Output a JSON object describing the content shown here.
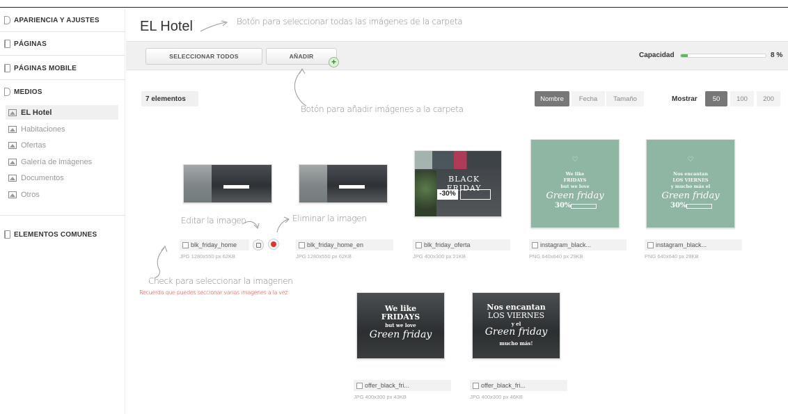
{
  "sidebar": {
    "sections": [
      {
        "label": "APARIENCIA Y AJUSTES"
      },
      {
        "label": "PÁGINAS"
      },
      {
        "label": "PÁGINAS MOBILE"
      },
      {
        "label": "MEDIOS"
      },
      {
        "label": "ELEMENTOS COMUNES"
      }
    ],
    "media_items": [
      {
        "label": "EL Hotel",
        "active": true
      },
      {
        "label": "Habitaciones"
      },
      {
        "label": "Ofertas"
      },
      {
        "label": "Galería de imágenes"
      },
      {
        "label": "Documentos"
      },
      {
        "label": "Otros"
      }
    ]
  },
  "main": {
    "title": "EL Hotel",
    "toolbar": {
      "select_all": "SELECCIONAR TODOS",
      "add": "AÑADIR",
      "add_plus": "+",
      "capacity_label": "Capacidad",
      "capacity_value": 8,
      "capacity_text": "8 %"
    },
    "count": "7 elementos",
    "sort": [
      "Nombre",
      "Fecha",
      "Tamaño"
    ],
    "show_label": "Mostrar",
    "show_options": [
      "50",
      "100",
      "200"
    ]
  },
  "files": [
    {
      "name": "blk_friday_home",
      "meta": "JPG  1280x550 px  62KB"
    },
    {
      "name": "blk_friday_home_en",
      "meta": "JPG  1280x550 px  62KB"
    },
    {
      "name": "blk_friday_oferta",
      "meta": "JPG  400x300 px  21KB",
      "art": {
        "title": "BLACK FRIDAY",
        "offer": "-30%"
      }
    },
    {
      "name": "instagram_black...",
      "meta": "PNG  640x640 px  29KB",
      "art": {
        "l1": "We like",
        "l2": "FRIDAYS",
        "l3": "but we love",
        "gf": "Green friday",
        "pct": "30%"
      }
    },
    {
      "name": "instagram_black...",
      "meta": "PNG  640x640 px  28KB",
      "art": {
        "l1": "Nos encantan",
        "l2": "LOS VIERNES",
        "l3": "y mucho más el",
        "gf": "Green friday",
        "pct": "30%"
      }
    },
    {
      "name": "offer_black_fri...",
      "meta": "JPG  400x300 px  43KB",
      "art": {
        "l1": "We like",
        "l2": "FRIDAYS",
        "l3": "but we love",
        "gf": "Green friday"
      }
    },
    {
      "name": "offer_black_fri...",
      "meta": "JPG  400x300 px  46KB",
      "art": {
        "l1": "Nos encantan",
        "l2": "LOS VIERNES",
        "l3": "y el",
        "gf": "Green friday",
        "l4": "mucho más!"
      }
    }
  ],
  "annotations": {
    "select_all": "Botón para seleccionar todas las imágenes de la carpeta",
    "add": "Botón para añadir imágenes a la carpeta",
    "edit": "Editar la imagen",
    "delete": "Eliminar la imagen",
    "check": "Check para seleccionar la imagenen",
    "remember": "Recuerda que puedes seccionar varias imagenes a la vez"
  }
}
